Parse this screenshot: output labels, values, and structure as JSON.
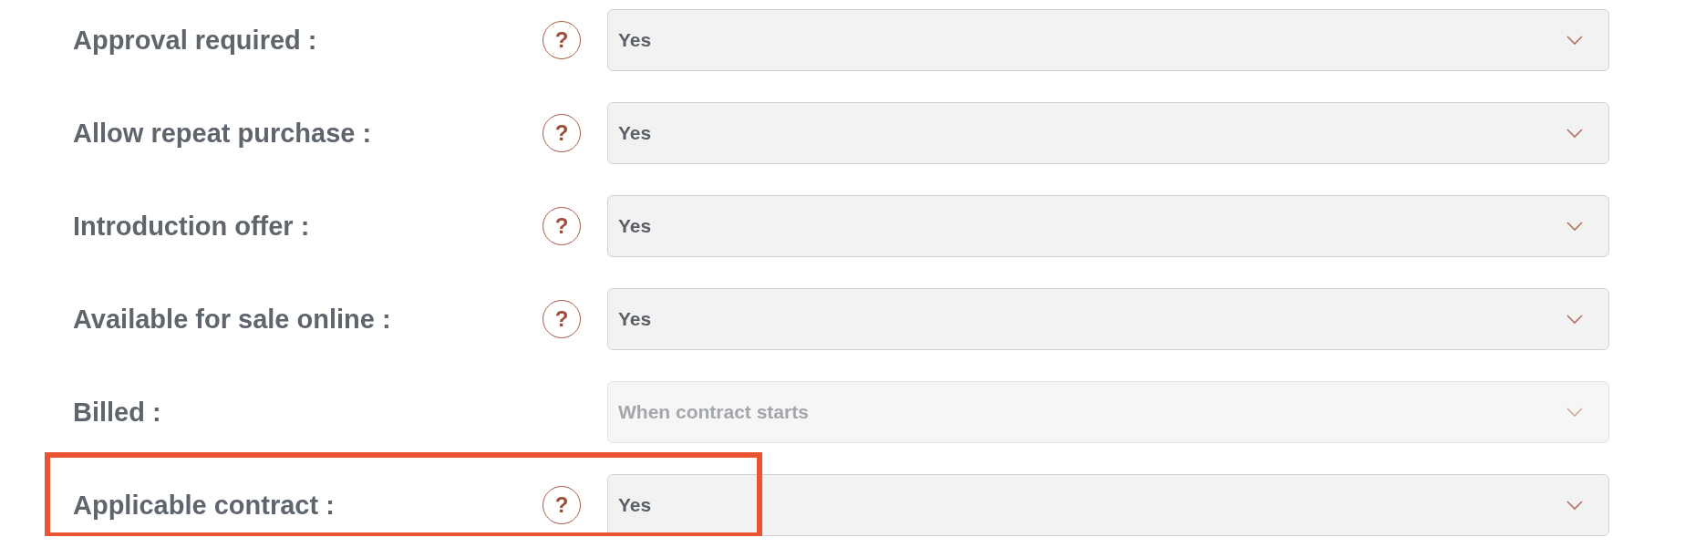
{
  "fields": [
    {
      "label": "Approval required :",
      "help": "?",
      "value": "Yes",
      "disabled": false,
      "highlighted": false
    },
    {
      "label": "Allow repeat purchase :",
      "help": "?",
      "value": "Yes",
      "disabled": false,
      "highlighted": false
    },
    {
      "label": "Introduction offer :",
      "help": "?",
      "value": "Yes",
      "disabled": false,
      "highlighted": false
    },
    {
      "label": "Available for sale online :",
      "help": "?",
      "value": "Yes",
      "disabled": false,
      "highlighted": false
    },
    {
      "label": "Billed :",
      "value": "When contract starts",
      "disabled": true,
      "highlighted": false
    },
    {
      "label": "Applicable contract :",
      "help": "?",
      "value": "Yes",
      "disabled": false,
      "highlighted": true
    }
  ]
}
